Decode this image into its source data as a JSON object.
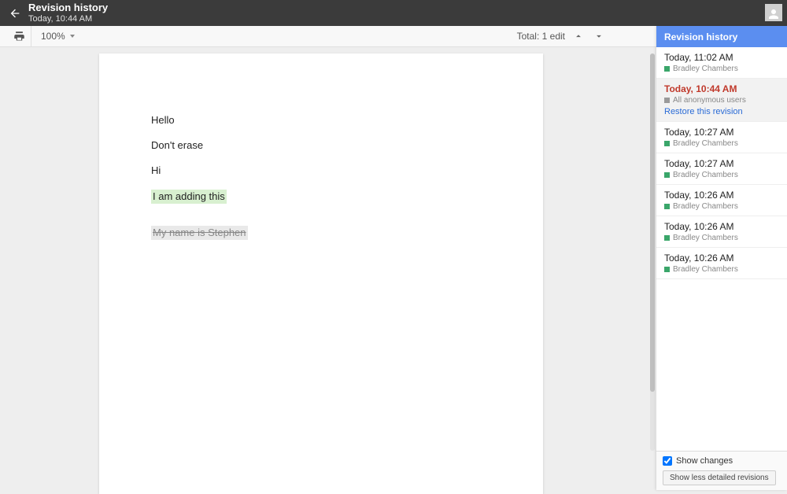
{
  "header": {
    "title": "Revision history",
    "subtitle": "Today, 10:44 AM"
  },
  "toolbar": {
    "zoom": "100%",
    "total_label": "Total: 1 edit"
  },
  "document": {
    "lines": [
      {
        "text": "Hello",
        "style": "normal"
      },
      {
        "text": "Don't erase",
        "style": "normal"
      },
      {
        "text": "Hi",
        "style": "normal"
      },
      {
        "text": "I am adding this ",
        "style": "hl"
      },
      {
        "text": "My name is Stephen",
        "style": "strike"
      }
    ]
  },
  "sidebar": {
    "header": "Revision history",
    "revisions": [
      {
        "time": "Today, 11:02 AM",
        "author": "Bradley Chambers",
        "color": "#3aa66a",
        "selected": false
      },
      {
        "time": "Today, 10:44 AM",
        "author": "All anonymous users",
        "color": "#9a9a9a",
        "selected": true,
        "restore": "Restore this revision"
      },
      {
        "time": "Today, 10:27 AM",
        "author": "Bradley Chambers",
        "color": "#3aa66a",
        "selected": false
      },
      {
        "time": "Today, 10:27 AM",
        "author": "Bradley Chambers",
        "color": "#3aa66a",
        "selected": false
      },
      {
        "time": "Today, 10:26 AM",
        "author": "Bradley Chambers",
        "color": "#3aa66a",
        "selected": false
      },
      {
        "time": "Today, 10:26 AM",
        "author": "Bradley Chambers",
        "color": "#3aa66a",
        "selected": false
      },
      {
        "time": "Today, 10:26 AM",
        "author": "Bradley Chambers",
        "color": "#3aa66a",
        "selected": false
      }
    ],
    "show_changes_label": "Show changes",
    "show_changes_checked": true,
    "detail_button": "Show less detailed revisions"
  }
}
